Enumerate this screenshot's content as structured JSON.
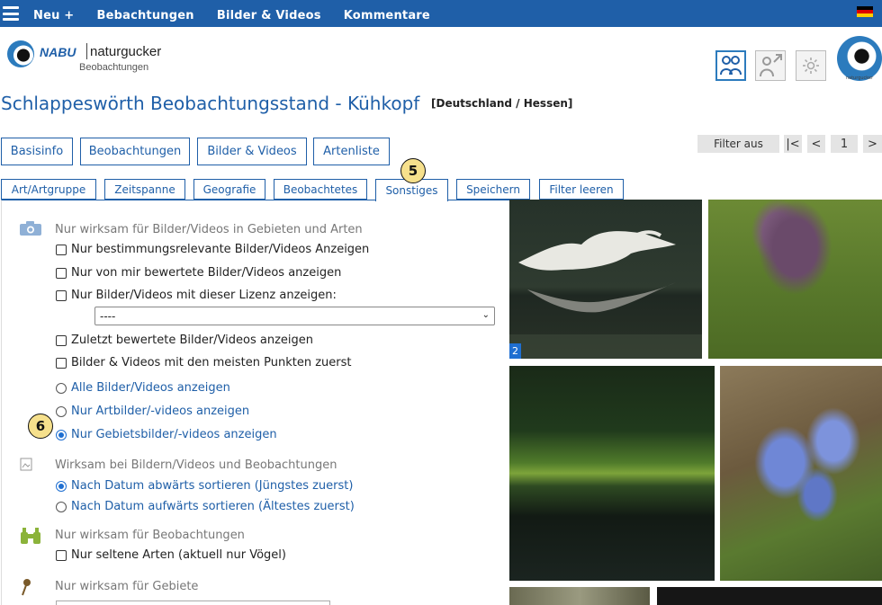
{
  "topnav": {
    "items": [
      {
        "label": "Neu +"
      },
      {
        "label": "Bebachtungen"
      },
      {
        "label": "Bilder & Videos"
      },
      {
        "label": "Kommentare"
      }
    ],
    "language_flag": "de-flag-icon"
  },
  "logo": {
    "brand": "NABU",
    "product": "naturgucker",
    "subtitle": "Beobachtungen",
    "small_caption": "naturgucker"
  },
  "page": {
    "title": "Schlappeswörth Beobachtungsstand - Kühkopf",
    "region": "[Deutschland / Hessen]"
  },
  "tabs": [
    {
      "label": "Basisinfo"
    },
    {
      "label": "Beobachtungen"
    },
    {
      "label": "Bilder & Videos"
    },
    {
      "label": "Artenliste"
    }
  ],
  "pager": {
    "filter_off": "Filter aus",
    "first": "|<",
    "prev": "<",
    "page": "1",
    "next": ">"
  },
  "filter_tabs": [
    {
      "label": "Art/Artgruppe"
    },
    {
      "label": "Zeitspanne"
    },
    {
      "label": "Geografie"
    },
    {
      "label": "Beobachtetes"
    },
    {
      "label": "Sonstiges"
    },
    {
      "label": "Speichern"
    },
    {
      "label": "Filter leeren"
    }
  ],
  "badges": {
    "b5": "5",
    "b6": "6"
  },
  "panel": {
    "section_media": "Nur wirksam für Bilder/Videos in Gebieten und Arten",
    "cb_relevant": "Nur bestimmungsrelevante Bilder/Videos Anzeigen",
    "cb_rated_by_me": "Nur von mir bewertete Bilder/Videos anzeigen",
    "cb_license": "Nur Bilder/Videos mit dieser Lizenz anzeigen:",
    "license_select": "----",
    "cb_recent_rated": "Zuletzt bewertete Bilder/Videos anzeigen",
    "cb_most_points": "Bilder & Videos mit den meisten Punkten zuerst",
    "rb_all": "Alle Bilder/Videos anzeigen",
    "rb_species": "Nur Artbilder/-videos anzeigen",
    "rb_area": "Nur Gebietsbilder/-videos anzeigen",
    "section_both": "Wirksam bei Bildern/Videos und Beobachtungen",
    "rb_date_desc": "Nach Datum abwärts sortieren (Jüngstes zuerst)",
    "rb_date_asc": "Nach Datum aufwärts sortieren (Ältestes zuerst)",
    "section_obs": "Nur wirksam für Beobachtungen",
    "cb_rare": "Nur seltene Arten (aktuell nur Vögel)",
    "section_areas": "Nur wirksam für Gebiete"
  },
  "photos": {
    "count_tag": "2"
  },
  "colors": {
    "brand_blue": "#1f5fa8",
    "badge_yellow": "#f6e08c"
  }
}
